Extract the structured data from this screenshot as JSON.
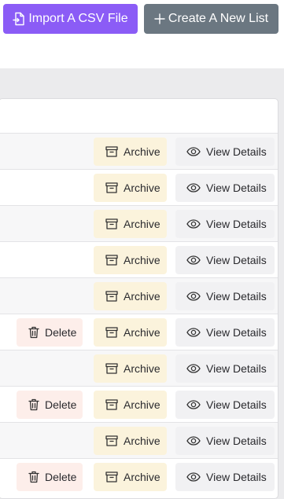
{
  "header": {
    "import_label": "Import A CSV File",
    "create_label": "Create A New List"
  },
  "colors": {
    "import_bg": "#8b5cf6",
    "create_bg": "#6b7781",
    "delete_bg": "#fdeeea",
    "archive_bg": "#fbf3dc",
    "view_bg": "#f1f1f3"
  },
  "icons": {
    "import": "file-import-icon",
    "create": "plus-icon",
    "delete": "trash-icon",
    "archive": "archive-box-icon",
    "view": "eye-icon"
  },
  "actions": {
    "delete_label": "Delete",
    "archive_label": "Archive",
    "view_label": "View Details"
  },
  "rows": [
    {
      "delete": false
    },
    {
      "delete": false
    },
    {
      "delete": false
    },
    {
      "delete": false
    },
    {
      "delete": false
    },
    {
      "delete": true
    },
    {
      "delete": false
    },
    {
      "delete": true
    },
    {
      "delete": false
    },
    {
      "delete": true
    }
  ]
}
